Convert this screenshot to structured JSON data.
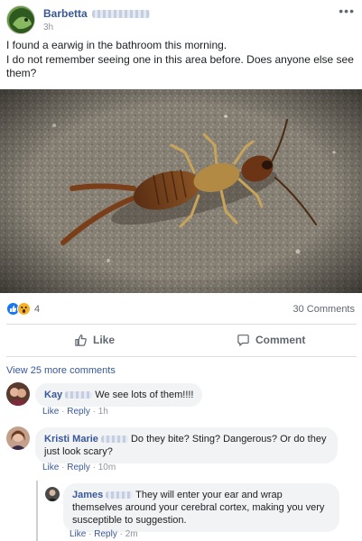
{
  "post": {
    "author": "Barbetta",
    "time": "3h",
    "more_icon": "ellipsis-icon",
    "text_lines": [
      "I found a earwig in the bathroom this morning.",
      "I do not remember seeing one in this area before. Does anyone else see them?"
    ]
  },
  "reactions": {
    "icons": [
      "like-reaction-icon",
      "wow-reaction-icon"
    ],
    "count": "4",
    "comments_count": "30 Comments"
  },
  "actions": {
    "like_label": "Like",
    "comment_label": "Comment"
  },
  "view_more": "View 25 more comments",
  "comments": [
    {
      "name": "Kay",
      "text": "We see lots of them!!!!",
      "like": "Like",
      "reply": "Reply",
      "time": "1h"
    },
    {
      "name": "Kristi Marie",
      "text": "Do they bite? Sting? Dangerous? Or do they just look scary?",
      "like": "Like",
      "reply": "Reply",
      "time": "10m"
    },
    {
      "name": "James",
      "text": "They will enter your ear and wrap themselves around your cerebral cortex, making you very susceptible to suggestion.",
      "like": "Like",
      "reply": "Reply",
      "time": "2m"
    }
  ],
  "colors": {
    "link_blue": "#385898",
    "like_blue": "#1877f2",
    "wow_yellow": "#f7b125",
    "meta_gray": "#90949c",
    "bubble_bg": "#f2f3f5"
  }
}
